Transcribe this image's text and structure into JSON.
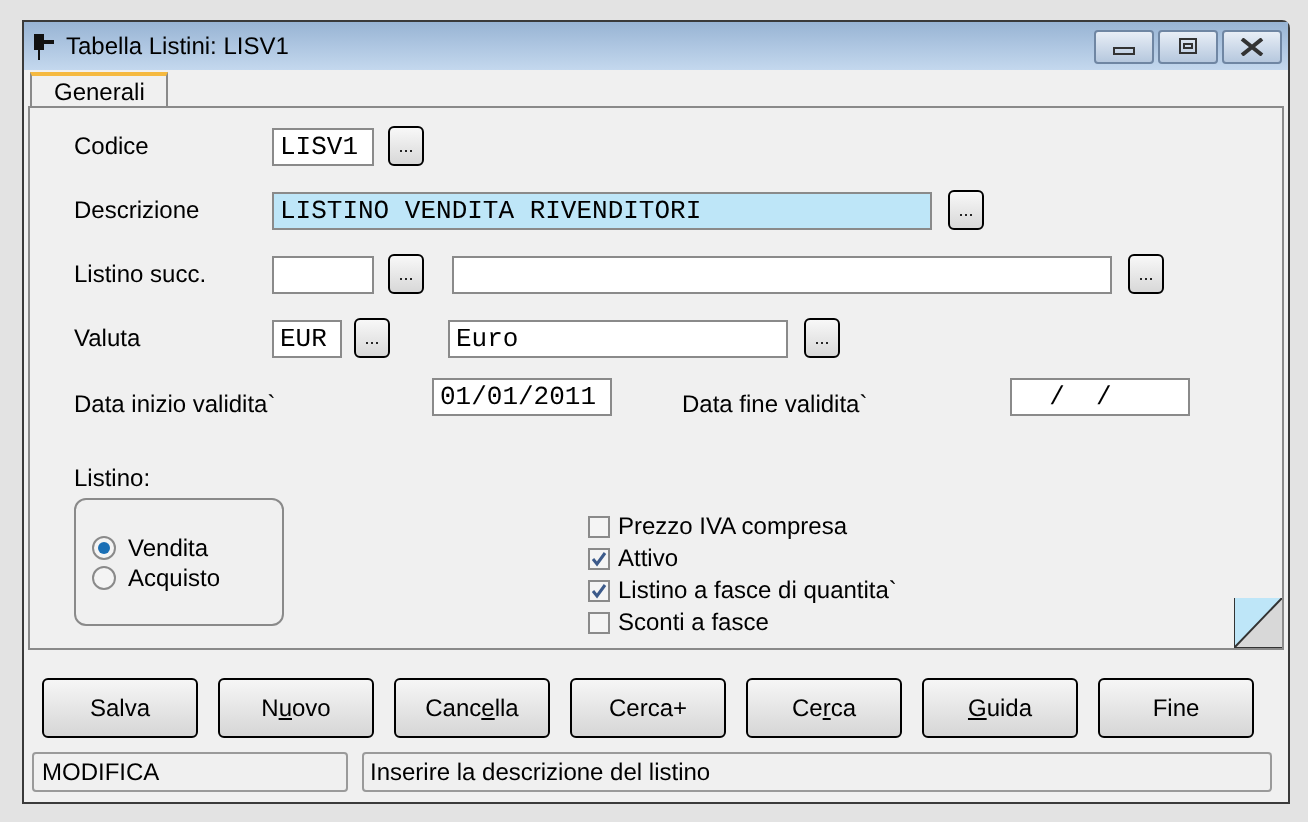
{
  "window": {
    "title": "Tabella Listini: LISV1"
  },
  "tabs": [
    {
      "label": "Generali",
      "selected": true
    }
  ],
  "fields": {
    "codice": {
      "label": "Codice",
      "value": "LISV1"
    },
    "descrizione": {
      "label": "Descrizione",
      "value": "LISTINO VENDITA RIVENDITORI",
      "focused": true
    },
    "listino_succ": {
      "label": "Listino succ."
    },
    "valuta": {
      "label": "Valuta",
      "value": "EUR",
      "description": "Euro"
    },
    "data_inizio": {
      "label": "Data inizio validita`",
      "value": "01/01/2011"
    },
    "data_fine": {
      "label": "Data fine validita`",
      "value": "  /  /"
    }
  },
  "listino": {
    "label": "Listino:",
    "options": [
      {
        "label": "Vendita",
        "selected": true
      },
      {
        "label": "Acquisto",
        "selected": false
      }
    ]
  },
  "checkboxes": [
    {
      "label": "Prezzo IVA compresa",
      "checked": false
    },
    {
      "label": "Attivo",
      "checked": true
    },
    {
      "label": "Listino a fasce di quantita`",
      "checked": true
    },
    {
      "label": "Sconti a fasce",
      "checked": false
    }
  ],
  "browse_button": "...",
  "buttons": [
    {
      "before": "Salva"
    },
    {
      "before": "N",
      "mnemonic": "u",
      "after": "ovo"
    },
    {
      "before": "Canc",
      "mnemonic": "e",
      "after": "lla"
    },
    {
      "before": "Cerca+"
    },
    {
      "before": "Ce",
      "mnemonic": "r",
      "after": "ca"
    },
    {
      "mnemonic": "G",
      "after": "uida"
    },
    {
      "before": "Fine"
    }
  ],
  "status_bar": {
    "mode": "MODIFICA",
    "message": "Inserire la descrizione del listino"
  }
}
